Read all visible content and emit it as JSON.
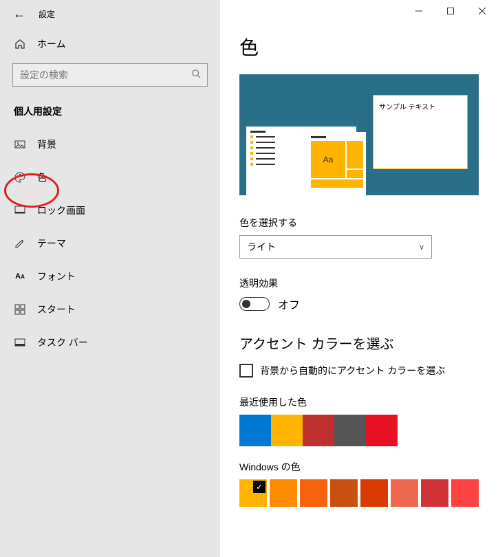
{
  "titlebar": {
    "title": "設定"
  },
  "sidebar": {
    "home": "ホーム",
    "search_placeholder": "設定の検索",
    "section": "個人用設定",
    "items": [
      {
        "label": "背景",
        "icon": "image-icon"
      },
      {
        "label": "色",
        "icon": "palette-icon",
        "selected": true
      },
      {
        "label": "ロック画面",
        "icon": "lock-screen-icon"
      },
      {
        "label": "テーマ",
        "icon": "theme-icon"
      },
      {
        "label": "フォント",
        "icon": "font-icon"
      },
      {
        "label": "スタート",
        "icon": "start-icon"
      },
      {
        "label": "タスク バー",
        "icon": "taskbar-icon"
      }
    ]
  },
  "main": {
    "title": "色",
    "preview": {
      "sample_text": "サンプル テキスト",
      "aa": "Aa"
    },
    "choose_color_label": "色を選択する",
    "mode_value": "ライト",
    "transparency_label": "透明効果",
    "transparency_value": "オフ",
    "accent_heading": "アクセント カラーを選ぶ",
    "auto_accent": "背景から自動的にアクセント カラーを選ぶ",
    "recent_label": "最近使用した色",
    "recent_colors": [
      "#0078d4",
      "#ffb400",
      "#c03030",
      "#555555",
      "#e81123"
    ],
    "windows_colors_label": "Windows の色",
    "windows_colors": [
      "#ffb400",
      "#ff8c00",
      "#f7630c",
      "#ca5010",
      "#da3b01",
      "#ef6950",
      "#d13438",
      "#ff4343"
    ],
    "windows_selected_index": 0
  }
}
